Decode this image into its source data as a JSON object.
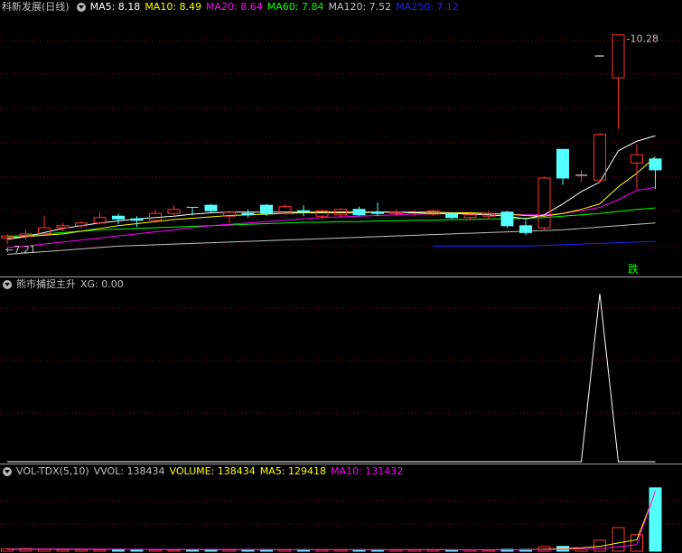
{
  "main_panel": {
    "title": "科新发展(日线)",
    "indicators": [
      {
        "label": "MA5: 8.18",
        "color": "#ffffff"
      },
      {
        "label": "MA10: 8.49",
        "color": "#ffff00"
      },
      {
        "label": "MA20: 8.64",
        "color": "#ff00ff"
      },
      {
        "label": "MA60: 7.84",
        "color": "#00ff00"
      },
      {
        "label": "MA120: 7.52",
        "color": "#c0c0c0"
      },
      {
        "label": "MA250: 7.12",
        "color": "#2020ff"
      }
    ],
    "high_label": "10.28",
    "low_label": "7.21",
    "signal_label": "跌"
  },
  "xg_panel": {
    "title": "熊市捕捉主升",
    "value_label": "XG: 0.00"
  },
  "vol_panel": {
    "title": "VOL-TDX(5,10)",
    "vvol_label": "VVOL: 138434",
    "volume_label": "VOLUME: 138434",
    "ma5_label": "MA5: 129418",
    "ma10_label": "MA10: 131432"
  },
  "colors": {
    "up": "#ff3232",
    "down": "#54ffff",
    "grid": "#8b0000",
    "ma5": "#ffffff",
    "ma10": "#ffff00",
    "ma20": "#ff00ff",
    "ma60": "#00ff00",
    "ma120": "#c0c0c0",
    "ma250": "#2020ff"
  },
  "chart_data": {
    "type": "candlestick",
    "ylim": [
      7.0,
      10.5
    ],
    "candles": [
      {
        "o": 7.3,
        "h": 7.36,
        "l": 7.21,
        "c": 7.33
      },
      {
        "o": 7.33,
        "h": 7.42,
        "l": 7.28,
        "c": 7.36
      },
      {
        "o": 7.36,
        "h": 7.62,
        "l": 7.34,
        "c": 7.45
      },
      {
        "o": 7.45,
        "h": 7.52,
        "l": 7.4,
        "c": 7.48
      },
      {
        "o": 7.48,
        "h": 7.55,
        "l": 7.44,
        "c": 7.52
      },
      {
        "o": 7.52,
        "h": 7.68,
        "l": 7.5,
        "c": 7.6
      },
      {
        "o": 7.62,
        "h": 7.66,
        "l": 7.5,
        "c": 7.58
      },
      {
        "o": 7.58,
        "h": 7.62,
        "l": 7.46,
        "c": 7.56
      },
      {
        "o": 7.56,
        "h": 7.72,
        "l": 7.52,
        "c": 7.66
      },
      {
        "o": 7.66,
        "h": 7.78,
        "l": 7.62,
        "c": 7.72
      },
      {
        "o": 7.75,
        "h": 7.75,
        "l": 7.63,
        "c": 7.74
      },
      {
        "o": 7.78,
        "h": 7.8,
        "l": 7.68,
        "c": 7.7
      },
      {
        "o": 7.62,
        "h": 7.7,
        "l": 7.52,
        "c": 7.68
      },
      {
        "o": 7.66,
        "h": 7.72,
        "l": 7.6,
        "c": 7.64
      },
      {
        "o": 7.78,
        "h": 7.8,
        "l": 7.62,
        "c": 7.66
      },
      {
        "o": 7.66,
        "h": 7.8,
        "l": 7.64,
        "c": 7.76
      },
      {
        "o": 7.7,
        "h": 7.78,
        "l": 7.62,
        "c": 7.68
      },
      {
        "o": 7.62,
        "h": 7.72,
        "l": 7.58,
        "c": 7.7
      },
      {
        "o": 7.64,
        "h": 7.74,
        "l": 7.6,
        "c": 7.72
      },
      {
        "o": 7.72,
        "h": 7.76,
        "l": 7.62,
        "c": 7.64
      },
      {
        "o": 7.68,
        "h": 7.82,
        "l": 7.62,
        "c": 7.66
      },
      {
        "o": 7.66,
        "h": 7.72,
        "l": 7.62,
        "c": 7.68
      },
      {
        "o": 7.67,
        "h": 7.72,
        "l": 7.62,
        "c": 7.67
      },
      {
        "o": 7.65,
        "h": 7.72,
        "l": 7.62,
        "c": 7.7
      },
      {
        "o": 7.66,
        "h": 7.68,
        "l": 7.58,
        "c": 7.6
      },
      {
        "o": 7.6,
        "h": 7.66,
        "l": 7.56,
        "c": 7.64
      },
      {
        "o": 7.62,
        "h": 7.7,
        "l": 7.58,
        "c": 7.66
      },
      {
        "o": 7.68,
        "h": 7.7,
        "l": 7.45,
        "c": 7.48
      },
      {
        "o": 7.48,
        "h": 7.56,
        "l": 7.34,
        "c": 7.38
      },
      {
        "o": 7.45,
        "h": 8.2,
        "l": 7.42,
        "c": 8.18
      },
      {
        "o": 8.6,
        "h": 8.6,
        "l": 8.08,
        "c": 8.18
      },
      {
        "o": 8.22,
        "h": 8.3,
        "l": 8.12,
        "c": 8.22
      },
      {
        "o": 8.15,
        "h": 8.84,
        "l": 8.12,
        "c": 8.82
      },
      {
        "o": 9.65,
        "h": 10.28,
        "l": 8.9,
        "c": 10.28
      },
      {
        "o": 8.4,
        "h": 8.68,
        "l": 8.02,
        "c": 8.52
      },
      {
        "o": 8.46,
        "h": 8.46,
        "l": 8.02,
        "c": 8.3
      }
    ],
    "ma5": [
      7.28,
      7.32,
      7.38,
      7.44,
      7.48,
      7.52,
      7.55,
      7.58,
      7.6,
      7.62,
      7.65,
      7.67,
      7.68,
      7.68,
      7.68,
      7.68,
      7.68,
      7.68,
      7.68,
      7.68,
      7.68,
      7.68,
      7.67,
      7.66,
      7.66,
      7.65,
      7.64,
      7.62,
      7.58,
      7.64,
      7.8,
      7.98,
      8.12,
      8.58,
      8.72,
      8.8
    ],
    "ma10": [
      7.3,
      7.32,
      7.34,
      7.36,
      7.4,
      7.44,
      7.48,
      7.51,
      7.54,
      7.57,
      7.59,
      7.61,
      7.63,
      7.64,
      7.65,
      7.66,
      7.67,
      7.67,
      7.67,
      7.67,
      7.68,
      7.68,
      7.68,
      7.68,
      7.67,
      7.67,
      7.66,
      7.65,
      7.63,
      7.62,
      7.66,
      7.72,
      7.8,
      8.05,
      8.25,
      8.49
    ],
    "ma20": [
      7.16,
      7.18,
      7.21,
      7.24,
      7.27,
      7.3,
      7.33,
      7.36,
      7.39,
      7.42,
      7.45,
      7.48,
      7.5,
      7.52,
      7.54,
      7.56,
      7.58,
      7.6,
      7.61,
      7.62,
      7.63,
      7.64,
      7.65,
      7.65,
      7.66,
      7.66,
      7.66,
      7.65,
      7.64,
      7.64,
      7.66,
      7.7,
      7.75,
      7.86,
      8.0,
      8.04
    ],
    "ma60": [
      7.32,
      7.34,
      7.36,
      7.38,
      7.4,
      7.42,
      7.43,
      7.44,
      7.45,
      7.46,
      7.47,
      7.48,
      7.49,
      7.5,
      7.51,
      7.52,
      7.53,
      7.53,
      7.54,
      7.54,
      7.55,
      7.55,
      7.56,
      7.56,
      7.57,
      7.57,
      7.58,
      7.58,
      7.59,
      7.6,
      7.62,
      7.64,
      7.66,
      7.69,
      7.72,
      7.74
    ],
    "ma120": [
      7.06,
      7.08,
      7.1,
      7.12,
      7.14,
      7.16,
      7.18,
      7.19,
      7.2,
      7.21,
      7.22,
      7.23,
      7.24,
      7.25,
      7.26,
      7.27,
      7.28,
      7.29,
      7.3,
      7.31,
      7.32,
      7.33,
      7.34,
      7.35,
      7.36,
      7.37,
      7.38,
      7.39,
      7.4,
      7.41,
      7.42,
      7.44,
      7.46,
      7.48,
      7.5,
      7.52
    ],
    "ma250": [
      null,
      null,
      null,
      null,
      null,
      null,
      null,
      null,
      null,
      null,
      null,
      null,
      null,
      null,
      null,
      null,
      null,
      null,
      null,
      null,
      null,
      null,
      null,
      7.18,
      7.18,
      7.18,
      7.18,
      7.18,
      7.18,
      7.19,
      7.2,
      7.21,
      7.22,
      7.23,
      7.24,
      7.25
    ],
    "xg": [
      0,
      0,
      0,
      0,
      0,
      0,
      0,
      0,
      0,
      0,
      0,
      0,
      0,
      0,
      0,
      0,
      0,
      0,
      0,
      0,
      0,
      0,
      0,
      0,
      0,
      0,
      0,
      0,
      0,
      0,
      0,
      0,
      1,
      0,
      0,
      0
    ],
    "volume": [
      5200,
      5600,
      4800,
      3600,
      3400,
      3200,
      3300,
      2900,
      3000,
      2700,
      3400,
      3500,
      3600,
      3300,
      3300,
      3400,
      3200,
      3300,
      3000,
      3100,
      3000,
      3200,
      3000,
      3200,
      2600,
      2800,
      2500,
      4200,
      3800,
      10000,
      10500,
      4800,
      24000,
      51500,
      36000,
      138434
    ],
    "vol_ma5": [
      4600,
      4700,
      4800,
      4600,
      4500,
      4300,
      4100,
      3900,
      3600,
      3500,
      3400,
      3300,
      3300,
      3300,
      3300,
      3300,
      3300,
      3300,
      3300,
      3300,
      3200,
      3200,
      3200,
      3100,
      3100,
      3000,
      2900,
      3000,
      3100,
      4500,
      6000,
      7400,
      10500,
      18000,
      25000,
      129418
    ],
    "vol_ma10": [
      4200,
      4300,
      4400,
      4400,
      4300,
      4200,
      4100,
      4000,
      3900,
      3800,
      3700,
      3600,
      3500,
      3400,
      3400,
      3300,
      3300,
      3300,
      3300,
      3300,
      3300,
      3200,
      3200,
      3200,
      3200,
      3100,
      3100,
      3100,
      3100,
      3700,
      4300,
      4800,
      6000,
      9800,
      14000,
      131432
    ]
  }
}
